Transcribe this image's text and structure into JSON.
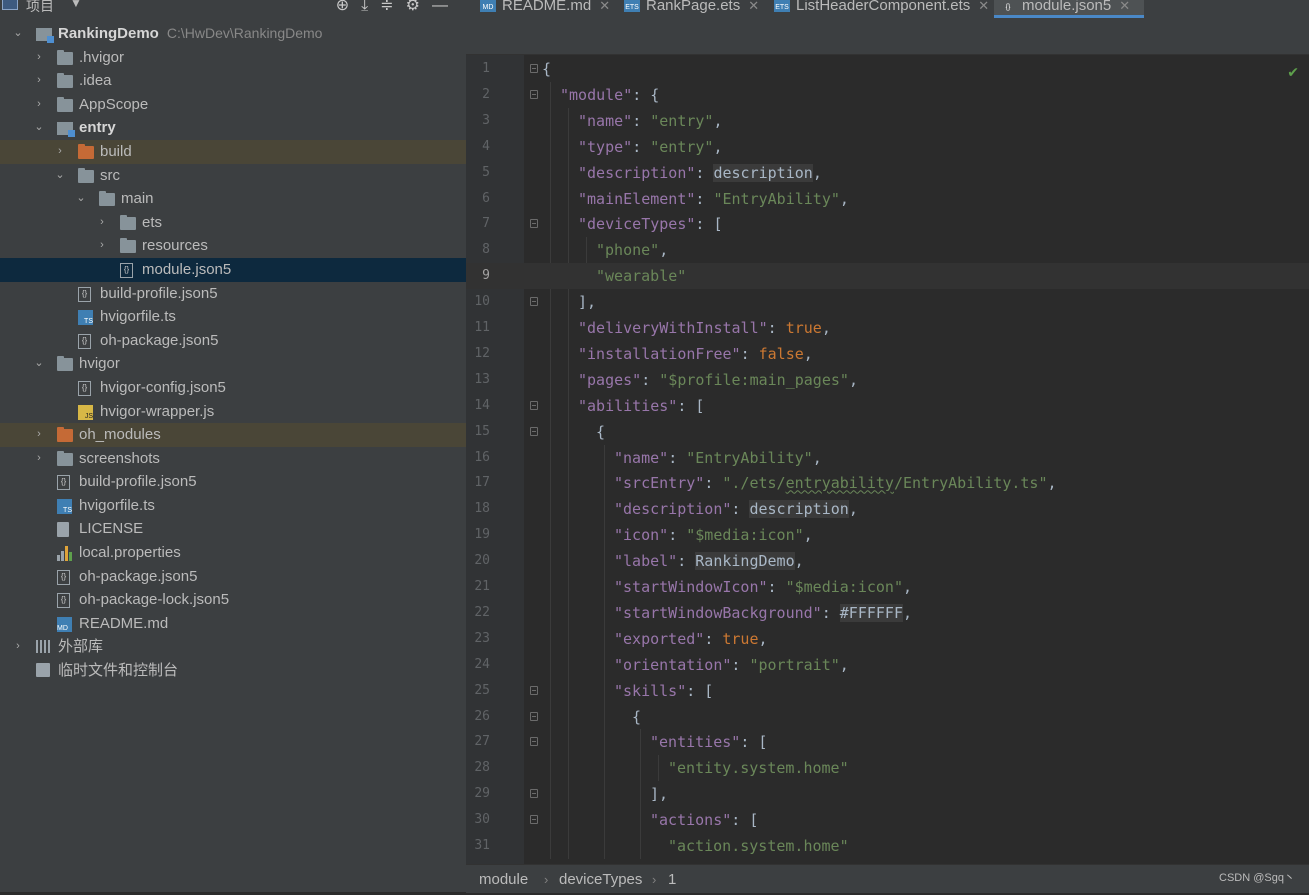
{
  "project_panel": {
    "title": "项目",
    "tree": [
      {
        "label": "RankingDemo",
        "path": "C:\\HwDev\\RankingDemo",
        "depth": 0,
        "arrow": "⌄",
        "icon": "module",
        "style": "root"
      },
      {
        "label": ".hvigor",
        "depth": 1,
        "arrow": "›",
        "icon": "folder"
      },
      {
        "label": ".idea",
        "depth": 1,
        "arrow": "›",
        "icon": "folder"
      },
      {
        "label": "AppScope",
        "depth": 1,
        "arrow": "›",
        "icon": "folder"
      },
      {
        "label": "entry",
        "depth": 1,
        "arrow": "⌄",
        "icon": "module",
        "style": "bold"
      },
      {
        "label": "build",
        "depth": 2,
        "arrow": "›",
        "icon": "folder-orange",
        "highlight": "excluded"
      },
      {
        "label": "src",
        "depth": 2,
        "arrow": "⌄",
        "icon": "folder"
      },
      {
        "label": "main",
        "depth": 3,
        "arrow": "⌄",
        "icon": "folder"
      },
      {
        "label": "ets",
        "depth": 4,
        "arrow": "›",
        "icon": "folder"
      },
      {
        "label": "resources",
        "depth": 4,
        "arrow": "›",
        "icon": "folder"
      },
      {
        "label": "module.json5",
        "depth": 4,
        "arrow": "",
        "icon": "json",
        "highlight": "selected"
      },
      {
        "label": "build-profile.json5",
        "depth": 2,
        "arrow": "",
        "icon": "json"
      },
      {
        "label": "hvigorfile.ts",
        "depth": 2,
        "arrow": "",
        "icon": "ts"
      },
      {
        "label": "oh-package.json5",
        "depth": 2,
        "arrow": "",
        "icon": "json"
      },
      {
        "label": "hvigor",
        "depth": 1,
        "arrow": "⌄",
        "icon": "folder"
      },
      {
        "label": "hvigor-config.json5",
        "depth": 2,
        "arrow": "",
        "icon": "json"
      },
      {
        "label": "hvigor-wrapper.js",
        "depth": 2,
        "arrow": "",
        "icon": "js"
      },
      {
        "label": "oh_modules",
        "depth": 1,
        "arrow": "›",
        "icon": "folder-orange",
        "highlight": "excluded"
      },
      {
        "label": "screenshots",
        "depth": 1,
        "arrow": "›",
        "icon": "folder"
      },
      {
        "label": "build-profile.json5",
        "depth": 1,
        "arrow": "",
        "icon": "json"
      },
      {
        "label": "hvigorfile.ts",
        "depth": 1,
        "arrow": "",
        "icon": "ts"
      },
      {
        "label": "LICENSE",
        "depth": 1,
        "arrow": "",
        "icon": "file"
      },
      {
        "label": "local.properties",
        "depth": 1,
        "arrow": "",
        "icon": "props"
      },
      {
        "label": "oh-package.json5",
        "depth": 1,
        "arrow": "",
        "icon": "json"
      },
      {
        "label": "oh-package-lock.json5",
        "depth": 1,
        "arrow": "",
        "icon": "json"
      },
      {
        "label": "README.md",
        "depth": 1,
        "arrow": "",
        "icon": "md"
      },
      {
        "label": "外部库",
        "depth": 0,
        "arrow": "›",
        "icon": "lib"
      },
      {
        "label": "临时文件和控制台",
        "depth": 0,
        "arrow": "",
        "icon": "scratch"
      }
    ]
  },
  "tabs": [
    {
      "label": "README.md",
      "icon": "MD",
      "icon_color": "#3f7fb3",
      "active": false
    },
    {
      "label": "RankPage.ets",
      "icon": "ETS",
      "icon_color": "#3f7fb3",
      "active": false
    },
    {
      "label": "ListHeaderComponent.ets",
      "icon": "ETS",
      "icon_color": "#3f7fb3",
      "active": false
    },
    {
      "label": "module.json5",
      "icon": "{}",
      "icon_color": "#4e5254",
      "active": true
    }
  ],
  "editor": {
    "current_line": 9,
    "lines": [
      [
        [
          "p",
          "{"
        ]
      ],
      [
        [
          "k",
          "\"module\""
        ],
        [
          "p",
          ": {"
        ]
      ],
      [
        [
          "k",
          "\"name\""
        ],
        [
          "p",
          ": "
        ],
        [
          "s",
          "\"entry\""
        ],
        [
          "p",
          ","
        ]
      ],
      [
        [
          "k",
          "\"type\""
        ],
        [
          "p",
          ": "
        ],
        [
          "s",
          "\"entry\""
        ],
        [
          "p",
          ","
        ]
      ],
      [
        [
          "k",
          "\"description\""
        ],
        [
          "p",
          ": "
        ],
        [
          "ref",
          "description"
        ],
        [
          "p",
          ","
        ]
      ],
      [
        [
          "k",
          "\"mainElement\""
        ],
        [
          "p",
          ": "
        ],
        [
          "s",
          "\"EntryAbility\""
        ],
        [
          "p",
          ","
        ]
      ],
      [
        [
          "k",
          "\"deviceTypes\""
        ],
        [
          "p",
          ": ["
        ]
      ],
      [
        [
          "s",
          "\"phone\""
        ],
        [
          "p",
          ","
        ]
      ],
      [
        [
          "s",
          "\"wearable\""
        ]
      ],
      [
        [
          "p",
          "],"
        ]
      ],
      [
        [
          "k",
          "\"deliveryWithInstall\""
        ],
        [
          "p",
          ": "
        ],
        [
          "kw",
          "true"
        ],
        [
          "p",
          ","
        ]
      ],
      [
        [
          "k",
          "\"installationFree\""
        ],
        [
          "p",
          ": "
        ],
        [
          "kw",
          "false"
        ],
        [
          "p",
          ","
        ]
      ],
      [
        [
          "k",
          "\"pages\""
        ],
        [
          "p",
          ": "
        ],
        [
          "s",
          "\"$profile:main_pages\""
        ],
        [
          "p",
          ","
        ]
      ],
      [
        [
          "k",
          "\"abilities\""
        ],
        [
          "p",
          ": ["
        ]
      ],
      [
        [
          "p",
          "{"
        ]
      ],
      [
        [
          "k",
          "\"name\""
        ],
        [
          "p",
          ": "
        ],
        [
          "s",
          "\"EntryAbility\""
        ],
        [
          "p",
          ","
        ]
      ],
      [
        [
          "k",
          "\"srcEntry\""
        ],
        [
          "p",
          ": "
        ],
        [
          "s",
          "\"./ets/"
        ],
        [
          "sq",
          "entryability"
        ],
        [
          "s",
          "/EntryAbility.ts\""
        ],
        [
          "p",
          ","
        ]
      ],
      [
        [
          "k",
          "\"description\""
        ],
        [
          "p",
          ": "
        ],
        [
          "ref",
          "description"
        ],
        [
          "p",
          ","
        ]
      ],
      [
        [
          "k",
          "\"icon\""
        ],
        [
          "p",
          ": "
        ],
        [
          "s",
          "\"$media:icon\""
        ],
        [
          "p",
          ","
        ]
      ],
      [
        [
          "k",
          "\"label\""
        ],
        [
          "p",
          ": "
        ],
        [
          "ref",
          "RankingDemo"
        ],
        [
          "p",
          ","
        ]
      ],
      [
        [
          "k",
          "\"startWindowIcon\""
        ],
        [
          "p",
          ": "
        ],
        [
          "s",
          "\"$media:icon\""
        ],
        [
          "p",
          ","
        ]
      ],
      [
        [
          "k",
          "\"startWindowBackground\""
        ],
        [
          "p",
          ": "
        ],
        [
          "ref",
          "#FFFFFF"
        ],
        [
          "p",
          ","
        ]
      ],
      [
        [
          "k",
          "\"exported\""
        ],
        [
          "p",
          ": "
        ],
        [
          "kw",
          "true"
        ],
        [
          "p",
          ","
        ]
      ],
      [
        [
          "k",
          "\"orientation\""
        ],
        [
          "p",
          ": "
        ],
        [
          "s",
          "\"portrait\""
        ],
        [
          "p",
          ","
        ]
      ],
      [
        [
          "k",
          "\"skills\""
        ],
        [
          "p",
          ": ["
        ]
      ],
      [
        [
          "p",
          "{"
        ]
      ],
      [
        [
          "k",
          "\"entities\""
        ],
        [
          "p",
          ": ["
        ]
      ],
      [
        [
          "s",
          "\"entity.system.home\""
        ]
      ],
      [
        [
          "p",
          "],"
        ]
      ],
      [
        [
          "k",
          "\"actions\""
        ],
        [
          "p",
          ": ["
        ]
      ],
      [
        [
          "s",
          "\"action.system.home\""
        ]
      ]
    ],
    "indents": [
      0,
      1,
      2,
      2,
      2,
      2,
      2,
      3,
      3,
      2,
      2,
      2,
      2,
      2,
      3,
      4,
      4,
      4,
      4,
      4,
      4,
      4,
      4,
      4,
      4,
      5,
      6,
      7,
      6,
      6,
      7
    ],
    "fold_lines": [
      1,
      2,
      7,
      10,
      14,
      15,
      25,
      26,
      27,
      29,
      30
    ]
  },
  "statusbar": {
    "crumbs": [
      "module",
      "deviceTypes",
      "1"
    ],
    "watermark": "CSDN @Sgq丶"
  }
}
